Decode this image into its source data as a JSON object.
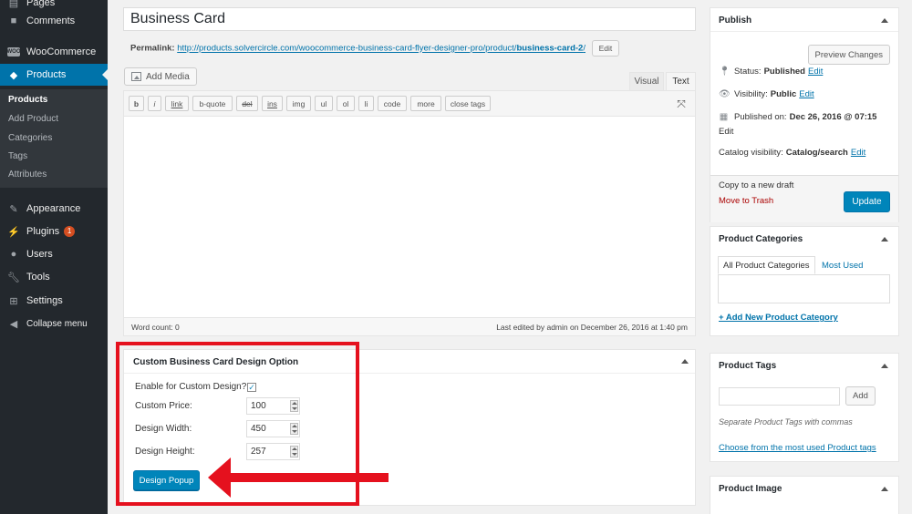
{
  "sidebar": {
    "items": [
      {
        "label": "Pages",
        "icon": "pages-icon"
      },
      {
        "label": "Comments",
        "icon": "comments-icon"
      },
      {
        "label": "WooCommerce",
        "icon": "woocommerce-icon"
      },
      {
        "label": "Products",
        "icon": "products-icon"
      },
      {
        "label": "Appearance",
        "icon": "appearance-icon"
      },
      {
        "label": "Plugins",
        "icon": "plugins-icon",
        "badge": "1"
      },
      {
        "label": "Users",
        "icon": "users-icon"
      },
      {
        "label": "Tools",
        "icon": "tools-icon"
      },
      {
        "label": "Settings",
        "icon": "settings-icon"
      },
      {
        "label": "Collapse menu",
        "icon": "collapse-icon"
      }
    ],
    "woo_logo_text": "WOO",
    "submenu": [
      "Products",
      "Add Product",
      "Categories",
      "Tags",
      "Attributes"
    ]
  },
  "editor": {
    "title": "Business Card",
    "permalink_label": "Permalink:",
    "permalink_base": "http://products.solvercircle.com/woocommerce-business-card-flyer-designer-pro/product/",
    "permalink_slug": "business-card-2",
    "permalink_tail": "/",
    "edit_label": "Edit",
    "add_media_label": "Add Media",
    "tab_visual": "Visual",
    "tab_text": "Text",
    "toolbar": [
      "b",
      "i",
      "link",
      "b-quote",
      "del",
      "ins",
      "img",
      "ul",
      "ol",
      "li",
      "code",
      "more",
      "close tags"
    ],
    "word_count": "Word count: 0",
    "last_edited": "Last edited by admin on December 26, 2016 at 1:40 pm"
  },
  "custom_box": {
    "title": "Custom Business Card Design Option",
    "enable_label": "Enable for Custom Design?:",
    "enable_checked": "✓",
    "price_label": "Custom Price:",
    "price_value": "100",
    "width_label": "Design Width:",
    "width_value": "450",
    "height_label": "Design Height:",
    "height_value": "257",
    "popup_button": "Design Popup"
  },
  "annotation": {
    "color": "#e5111e"
  },
  "publish": {
    "title": "Publish",
    "preview_label": "Preview Changes",
    "status_label": "Status:",
    "status_value": "Published",
    "visibility_label": "Visibility:",
    "visibility_value": "Public",
    "published_label": "Published on:",
    "published_value": "Dec 26, 2016 @ 07:15",
    "catalog_label": "Catalog visibility:",
    "catalog_value": "Catalog/search",
    "edit_link": "Edit",
    "copy_draft": "Copy to a new draft",
    "trash": "Move to Trash",
    "update": "Update"
  },
  "categories": {
    "title": "Product Categories",
    "tab_all": "All Product Categories",
    "tab_most": "Most Used",
    "add_link": "+ Add New Product Category"
  },
  "tags": {
    "title": "Product Tags",
    "add_label": "Add",
    "hint": "Separate Product Tags with commas",
    "choose_link": "Choose from the most used Product tags"
  },
  "image": {
    "title": "Product Image"
  },
  "colors": {
    "accent": "#0073aa",
    "sidebar": "#23282d",
    "button": "#0085ba"
  }
}
